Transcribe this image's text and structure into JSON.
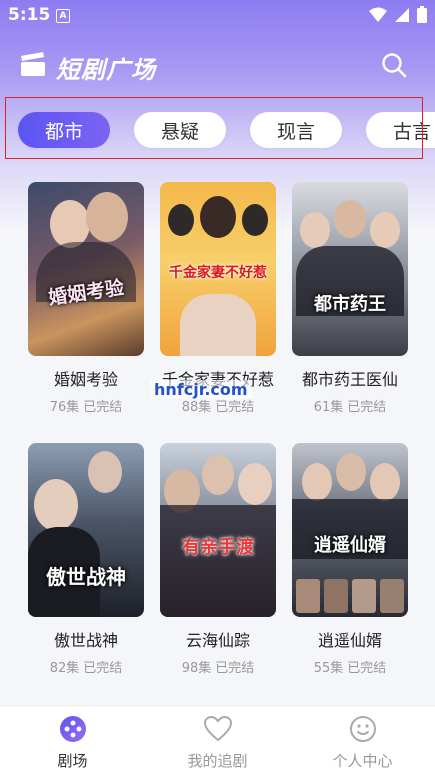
{
  "status_bar": {
    "time": "5:15",
    "notice_glyph": "A"
  },
  "header": {
    "title": "短剧广场",
    "logo_icon": "clapperboard-icon",
    "search_icon": "search-icon"
  },
  "tabs": [
    {
      "label": "都市",
      "active": true
    },
    {
      "label": "悬疑",
      "active": false
    },
    {
      "label": "现言",
      "active": false
    },
    {
      "label": "古言",
      "active": false
    }
  ],
  "dramas": [
    {
      "title": "婚姻考验",
      "episodes": "76集",
      "status": "已完结",
      "poster_text": "婚姻考验"
    },
    {
      "title": "千金家妻不好惹",
      "episodes": "88集",
      "status": "已完结",
      "poster_text": "千金家妻不好惹"
    },
    {
      "title": "都市药王医仙",
      "episodes": "61集",
      "status": "已完结",
      "poster_text": "都市药王"
    },
    {
      "title": "傲世战神",
      "episodes": "82集",
      "status": "已完结",
      "poster_text": "傲世战神"
    },
    {
      "title": "云海仙踪",
      "episodes": "98集",
      "status": "已完结",
      "poster_text": "有亲手渡"
    },
    {
      "title": "逍遥仙婿",
      "episodes": "55集",
      "status": "已完结",
      "poster_text": "逍遥仙婿"
    }
  ],
  "watermark": "hnfcjr.com",
  "bottom_nav": [
    {
      "label": "剧场",
      "icon": "theater-icon",
      "active": true
    },
    {
      "label": "我的追剧",
      "icon": "heart-icon",
      "active": false
    },
    {
      "label": "个人中心",
      "icon": "smiley-icon",
      "active": false
    }
  ],
  "colors": {
    "accent": "#5a55f2",
    "accent_end": "#7d63f3",
    "header_bg": "#8d7cf2",
    "highlight": "#e0202a"
  }
}
